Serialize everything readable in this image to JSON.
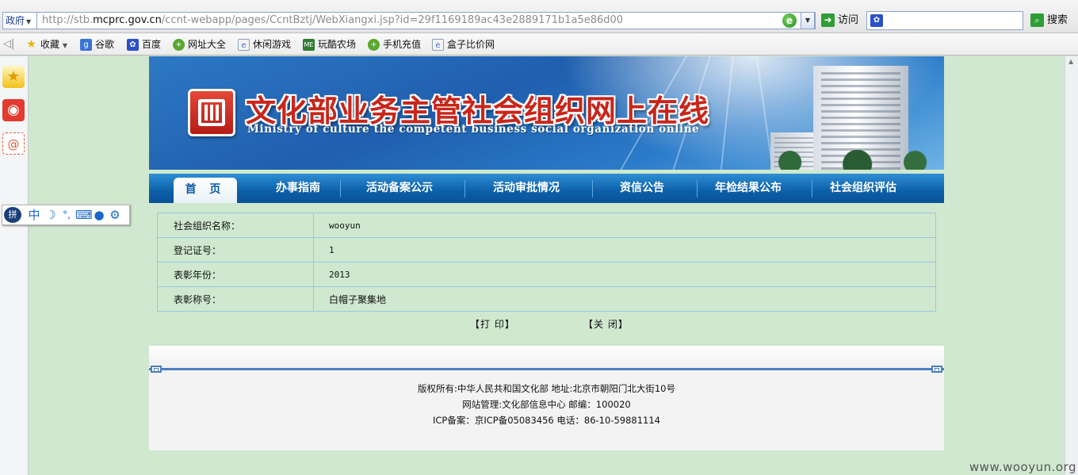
{
  "browser": {
    "zone_label": "政府",
    "url_prefix": "http://stb.",
    "url_host": "mcprc.gov.cn",
    "url_path": "/ccnt-webapp/pages/CcntBztj/WebXiangxi.jsp?id=29f1169189ac43e2889171b1a5e86d00",
    "go_label": "访问",
    "search_label": "搜索",
    "search_placeholder": "",
    "favorites": [
      {
        "label": "收藏",
        "icon": "star-icon",
        "color": "#e8b40c"
      },
      {
        "label": "谷歌",
        "icon": "google-icon",
        "color": "#3b73d6"
      },
      {
        "label": "百度",
        "icon": "baidu-icon",
        "color": "#2b50c9"
      },
      {
        "label": "网址大全",
        "icon": "globe-icon",
        "color": "#5aa72e"
      },
      {
        "label": "休闲游戏",
        "icon": "page-icon",
        "color": "#8aa0b8"
      },
      {
        "label": "玩酷农场",
        "icon": "farm-icon",
        "color": "#2e7d32"
      },
      {
        "label": "手机充值",
        "icon": "globe-icon",
        "color": "#5aa72e"
      },
      {
        "label": "盒子比价网",
        "icon": "page-icon",
        "color": "#8aa0b8"
      }
    ]
  },
  "side_icons": [
    "favorites-star-icon",
    "weibo-icon",
    "email-icon"
  ],
  "ime_bar": {
    "mode_char": "中",
    "icons": [
      "ime-logo-icon",
      "moon-icon",
      "punctuation-icon",
      "keyboard-icon",
      "microphone-icon",
      "gear-icon"
    ]
  },
  "site": {
    "title_cn": "文化部业务主管社会组织网上在线",
    "title_en": "Ministry of culture the competent business social organization online",
    "nav": [
      "首页",
      "办事指南",
      "活动备案公示",
      "活动审批情况",
      "资信公告",
      "年检结果公布",
      "社会组织评估"
    ],
    "home_label": "首 页"
  },
  "details": [
    {
      "label": "社会组织名称：",
      "value": "wooyun"
    },
    {
      "label": "登记证号：",
      "value": "1"
    },
    {
      "label": "表彰年份：",
      "value": "2013"
    },
    {
      "label": "表彰称号：",
      "value": "白帽子聚集地"
    }
  ],
  "actions": {
    "print": "【打 印】",
    "close": "【关 闭】"
  },
  "footer": {
    "line1": "版权所有:中华人民共和国文化部 地址:北京市朝阳门北大街10号",
    "line2": "网站管理:文化部信息中心 邮编：100020",
    "line3": "ICP备案：京ICP备05083456 电话：86-10-59881114"
  },
  "watermark": "www.wooyun.org",
  "colors": {
    "page_bg": "#cfe8cf",
    "nav_blue": "#0c5fa8",
    "title_red": "#c8261b",
    "footer_rule": "#4b7fc1"
  }
}
